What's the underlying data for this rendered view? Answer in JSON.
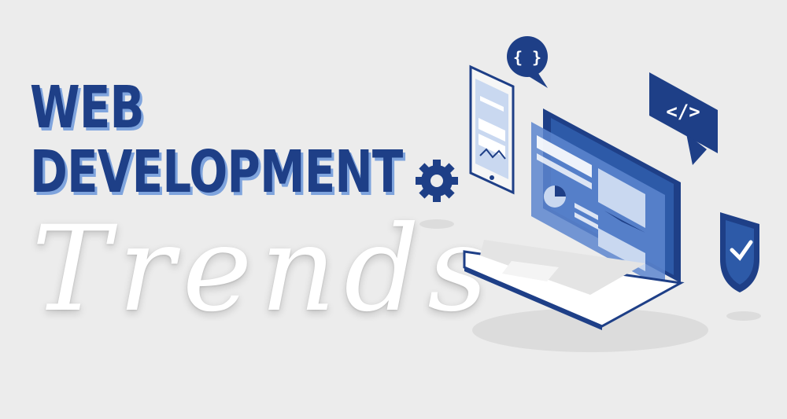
{
  "headline": {
    "line1": "WEB",
    "line2": "DEVELOPMENT"
  },
  "script_word": "Trends",
  "icons": {
    "code_bubble": "{ }",
    "tag_bubble": "</>"
  },
  "colors": {
    "background": "#ececec",
    "navy": "#1e3f87",
    "accent": "#7fa4dd",
    "white": "#ffffff"
  }
}
